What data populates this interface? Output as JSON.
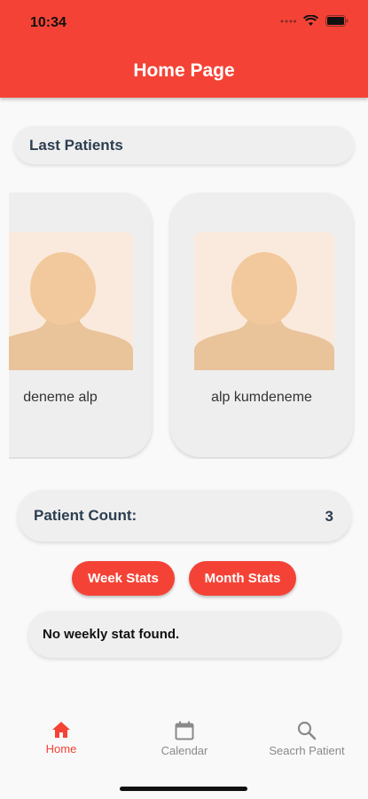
{
  "status_bar": {
    "time": "10:34"
  },
  "header": {
    "title": "Home Page"
  },
  "last_patients": {
    "title": "Last Patients",
    "patients": [
      {
        "name": "deneme alp",
        "avatar": "person-placeholder-icon"
      },
      {
        "name": "alp kumdeneme",
        "avatar": "person-placeholder-icon"
      }
    ]
  },
  "patient_count": {
    "label": "Patient Count:",
    "value": "3"
  },
  "stats": {
    "week_label": "Week Stats",
    "month_label": "Month Stats",
    "empty_message": "No weekly stat found."
  },
  "bottom_nav": {
    "items": [
      {
        "label": "Home",
        "icon": "home-icon",
        "active": true
      },
      {
        "label": "Calendar",
        "icon": "calendar-icon",
        "active": false
      },
      {
        "label": "Seacrh Patient",
        "icon": "search-icon",
        "active": false
      }
    ]
  },
  "colors": {
    "primary": "#f44336",
    "card": "#eeeeee",
    "text_dark": "#2c3e50"
  }
}
